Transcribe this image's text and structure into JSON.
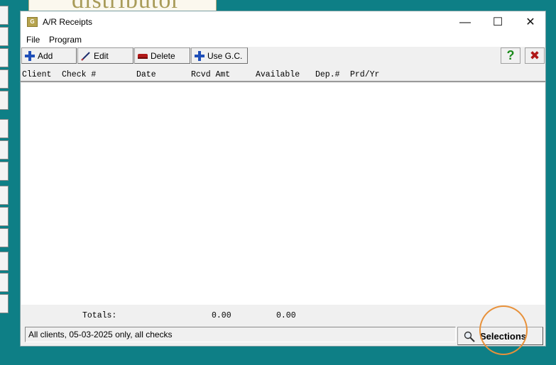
{
  "background_logo_text": "distributor",
  "window": {
    "title": "A/R Receipts",
    "controls": {
      "minimize": "—",
      "maximize": "☐",
      "close": "✕"
    }
  },
  "menu": [
    "File",
    "Program"
  ],
  "toolbar": {
    "add_label": "Add",
    "edit_label": "Edit",
    "delete_label": "Delete",
    "use_gc_label": "Use G.C.",
    "help_icon": "?",
    "exit_icon": "✖"
  },
  "columns": [
    "Client",
    "Check #",
    "Date",
    "Rcvd Amt",
    "Available",
    "Dep.#",
    "Prd/Yr"
  ],
  "rows": [],
  "totals": {
    "label": "Totals:",
    "rcvd_amt": "0.00",
    "available": "0.00"
  },
  "status_text": "All clients, 05-03-2025 only, all checks",
  "selections_label": "Selections",
  "colors": {
    "desktop": "#0e7f86",
    "accent_blue": "#1f4fb8",
    "help_green": "#1a8a1a",
    "exit_red": "#b01818",
    "highlight_orange": "#e8913a"
  }
}
